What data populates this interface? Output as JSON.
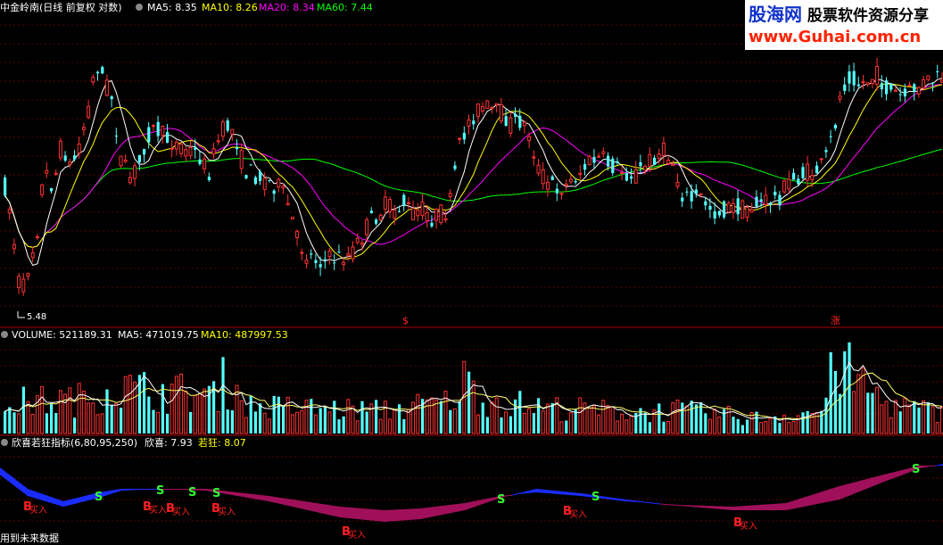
{
  "colors": {
    "up": "#ff3333",
    "down": "#54ffff",
    "ma5": "#ffffff",
    "ma10": "#ffff00",
    "ma20": "#ff00ff",
    "ma60": "#00ff00",
    "vol_ma10": "#ffff66",
    "panel_border": "#b00000",
    "band_blue": "#1a2cff",
    "band_purple": "#a0105a",
    "signal_s": "#33ff33",
    "signal_b": "#ff2020"
  },
  "price_panel": {
    "title": "中金岭南(日线 前复权 对数)",
    "ma5_label": "MA5: 8.35",
    "ma10_label": "MA10: 8.26",
    "ma20_label": "MA20: 8.34",
    "ma60_label": "MA60: 7.44",
    "low_marker": "5.48",
    "marker_s": "$",
    "marker_zhang": "涨"
  },
  "volume_panel": {
    "label": "VOLUME: 521189.31",
    "ma5_label": "MA5: 471019.75",
    "ma10_label": "MA10: 487997.53"
  },
  "indicator_panel": {
    "title": "欣喜若狂指标(6,80,95,250)",
    "xinxi_label": "欣喜: 7.93",
    "ruokuang_label": "若狂: 8.07",
    "signal_sell": "S",
    "signal_buy": "B",
    "buy_text": "买入",
    "footer_text": "用到未来数据"
  },
  "watermark": {
    "site": "股海网",
    "slogan": "股票软件资源分享",
    "url": "www.Guhai.com.cn"
  }
}
